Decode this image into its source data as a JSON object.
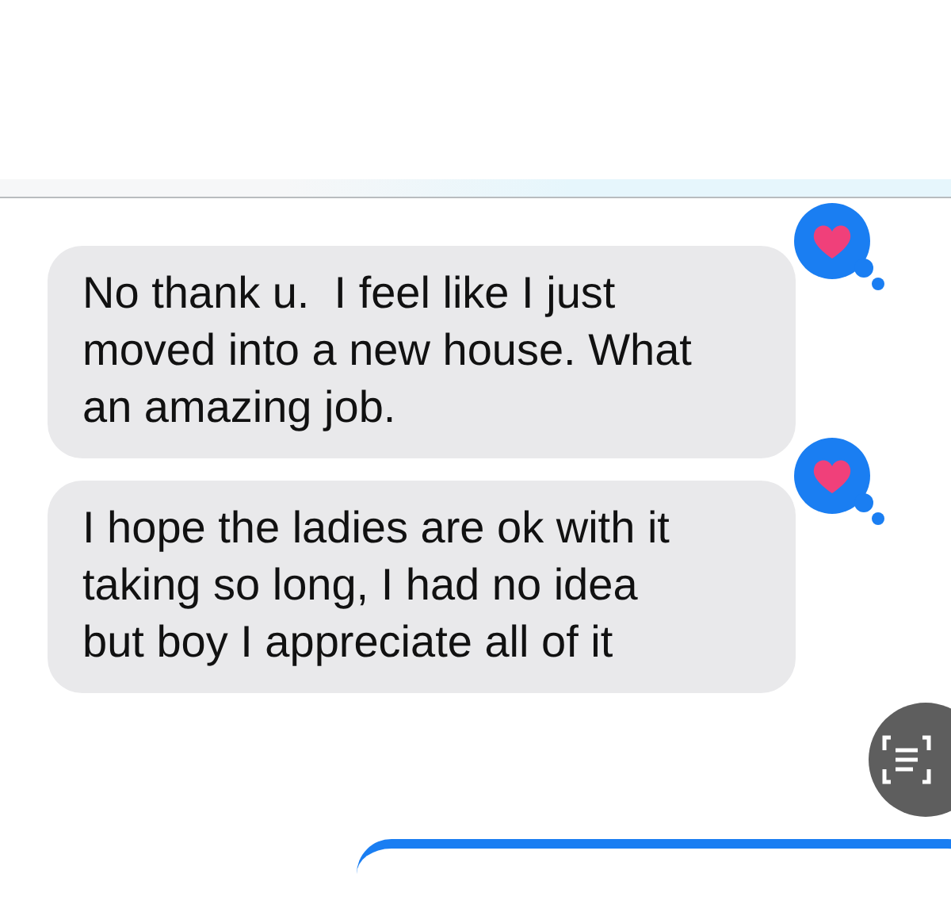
{
  "messages": [
    {
      "text": "No thank u.  I feel like I just moved into a new house. What an amazing job.",
      "hearted": true
    },
    {
      "text": "I hope the ladies are ok with it taking so long, I had no idea but boy I appreciate all of it",
      "hearted": true
    }
  ]
}
